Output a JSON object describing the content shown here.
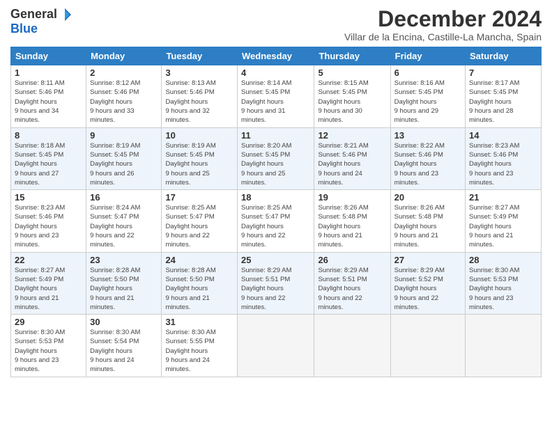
{
  "header": {
    "logo_general": "General",
    "logo_blue": "Blue",
    "month_title": "December 2024",
    "subtitle": "Villar de la Encina, Castille-La Mancha, Spain"
  },
  "days_of_week": [
    "Sunday",
    "Monday",
    "Tuesday",
    "Wednesday",
    "Thursday",
    "Friday",
    "Saturday"
  ],
  "weeks": [
    [
      {
        "num": "1",
        "sunrise": "8:11 AM",
        "sunset": "5:46 PM",
        "daylight": "9 hours and 34 minutes."
      },
      {
        "num": "2",
        "sunrise": "8:12 AM",
        "sunset": "5:46 PM",
        "daylight": "9 hours and 33 minutes."
      },
      {
        "num": "3",
        "sunrise": "8:13 AM",
        "sunset": "5:46 PM",
        "daylight": "9 hours and 32 minutes."
      },
      {
        "num": "4",
        "sunrise": "8:14 AM",
        "sunset": "5:45 PM",
        "daylight": "9 hours and 31 minutes."
      },
      {
        "num": "5",
        "sunrise": "8:15 AM",
        "sunset": "5:45 PM",
        "daylight": "9 hours and 30 minutes."
      },
      {
        "num": "6",
        "sunrise": "8:16 AM",
        "sunset": "5:45 PM",
        "daylight": "9 hours and 29 minutes."
      },
      {
        "num": "7",
        "sunrise": "8:17 AM",
        "sunset": "5:45 PM",
        "daylight": "9 hours and 28 minutes."
      }
    ],
    [
      {
        "num": "8",
        "sunrise": "8:18 AM",
        "sunset": "5:45 PM",
        "daylight": "9 hours and 27 minutes."
      },
      {
        "num": "9",
        "sunrise": "8:19 AM",
        "sunset": "5:45 PM",
        "daylight": "9 hours and 26 minutes."
      },
      {
        "num": "10",
        "sunrise": "8:19 AM",
        "sunset": "5:45 PM",
        "daylight": "9 hours and 25 minutes."
      },
      {
        "num": "11",
        "sunrise": "8:20 AM",
        "sunset": "5:45 PM",
        "daylight": "9 hours and 25 minutes."
      },
      {
        "num": "12",
        "sunrise": "8:21 AM",
        "sunset": "5:46 PM",
        "daylight": "9 hours and 24 minutes."
      },
      {
        "num": "13",
        "sunrise": "8:22 AM",
        "sunset": "5:46 PM",
        "daylight": "9 hours and 23 minutes."
      },
      {
        "num": "14",
        "sunrise": "8:23 AM",
        "sunset": "5:46 PM",
        "daylight": "9 hours and 23 minutes."
      }
    ],
    [
      {
        "num": "15",
        "sunrise": "8:23 AM",
        "sunset": "5:46 PM",
        "daylight": "9 hours and 23 minutes."
      },
      {
        "num": "16",
        "sunrise": "8:24 AM",
        "sunset": "5:47 PM",
        "daylight": "9 hours and 22 minutes."
      },
      {
        "num": "17",
        "sunrise": "8:25 AM",
        "sunset": "5:47 PM",
        "daylight": "9 hours and 22 minutes."
      },
      {
        "num": "18",
        "sunrise": "8:25 AM",
        "sunset": "5:47 PM",
        "daylight": "9 hours and 22 minutes."
      },
      {
        "num": "19",
        "sunrise": "8:26 AM",
        "sunset": "5:48 PM",
        "daylight": "9 hours and 21 minutes."
      },
      {
        "num": "20",
        "sunrise": "8:26 AM",
        "sunset": "5:48 PM",
        "daylight": "9 hours and 21 minutes."
      },
      {
        "num": "21",
        "sunrise": "8:27 AM",
        "sunset": "5:49 PM",
        "daylight": "9 hours and 21 minutes."
      }
    ],
    [
      {
        "num": "22",
        "sunrise": "8:27 AM",
        "sunset": "5:49 PM",
        "daylight": "9 hours and 21 minutes."
      },
      {
        "num": "23",
        "sunrise": "8:28 AM",
        "sunset": "5:50 PM",
        "daylight": "9 hours and 21 minutes."
      },
      {
        "num": "24",
        "sunrise": "8:28 AM",
        "sunset": "5:50 PM",
        "daylight": "9 hours and 21 minutes."
      },
      {
        "num": "25",
        "sunrise": "8:29 AM",
        "sunset": "5:51 PM",
        "daylight": "9 hours and 22 minutes."
      },
      {
        "num": "26",
        "sunrise": "8:29 AM",
        "sunset": "5:51 PM",
        "daylight": "9 hours and 22 minutes."
      },
      {
        "num": "27",
        "sunrise": "8:29 AM",
        "sunset": "5:52 PM",
        "daylight": "9 hours and 22 minutes."
      },
      {
        "num": "28",
        "sunrise": "8:30 AM",
        "sunset": "5:53 PM",
        "daylight": "9 hours and 23 minutes."
      }
    ],
    [
      {
        "num": "29",
        "sunrise": "8:30 AM",
        "sunset": "5:53 PM",
        "daylight": "9 hours and 23 minutes."
      },
      {
        "num": "30",
        "sunrise": "8:30 AM",
        "sunset": "5:54 PM",
        "daylight": "9 hours and 24 minutes."
      },
      {
        "num": "31",
        "sunrise": "8:30 AM",
        "sunset": "5:55 PM",
        "daylight": "9 hours and 24 minutes."
      },
      null,
      null,
      null,
      null
    ]
  ],
  "labels": {
    "sunrise": "Sunrise:",
    "sunset": "Sunset:",
    "daylight": "Daylight hours"
  }
}
